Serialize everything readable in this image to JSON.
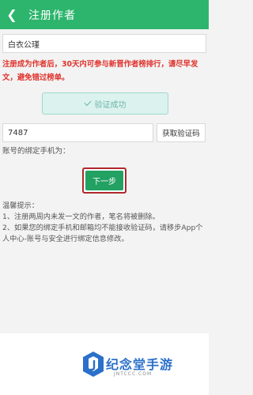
{
  "header": {
    "back_icon": "chevron-left-icon",
    "title": "注册作者"
  },
  "form": {
    "name_value": "白衣公瑾",
    "warning": "注册成为作者后，30天内可参与新晋作者榜排行，请尽早发文，避免错过榜单。",
    "verify_status": "验证成功",
    "code_value": "7487",
    "get_code_label": "获取验证码",
    "phone_hint": "账号的绑定手机为：",
    "next_label": "下一步"
  },
  "tips": {
    "title": "温馨提示：",
    "items": [
      "1、注册两周内未发一文的作者，笔名将被删除。",
      "2、如果您的绑定手机和邮箱均不能接收验证码，请移步App个人中心-账号与安全进行绑定信息修改。"
    ]
  },
  "watermark": {
    "text": "纪念堂手游",
    "sub": "JNTCCC.COM"
  },
  "colors": {
    "primary": "#2db46d",
    "warning": "#e0322b",
    "next_button": "#22a162",
    "highlight_border": "#b0282b"
  }
}
